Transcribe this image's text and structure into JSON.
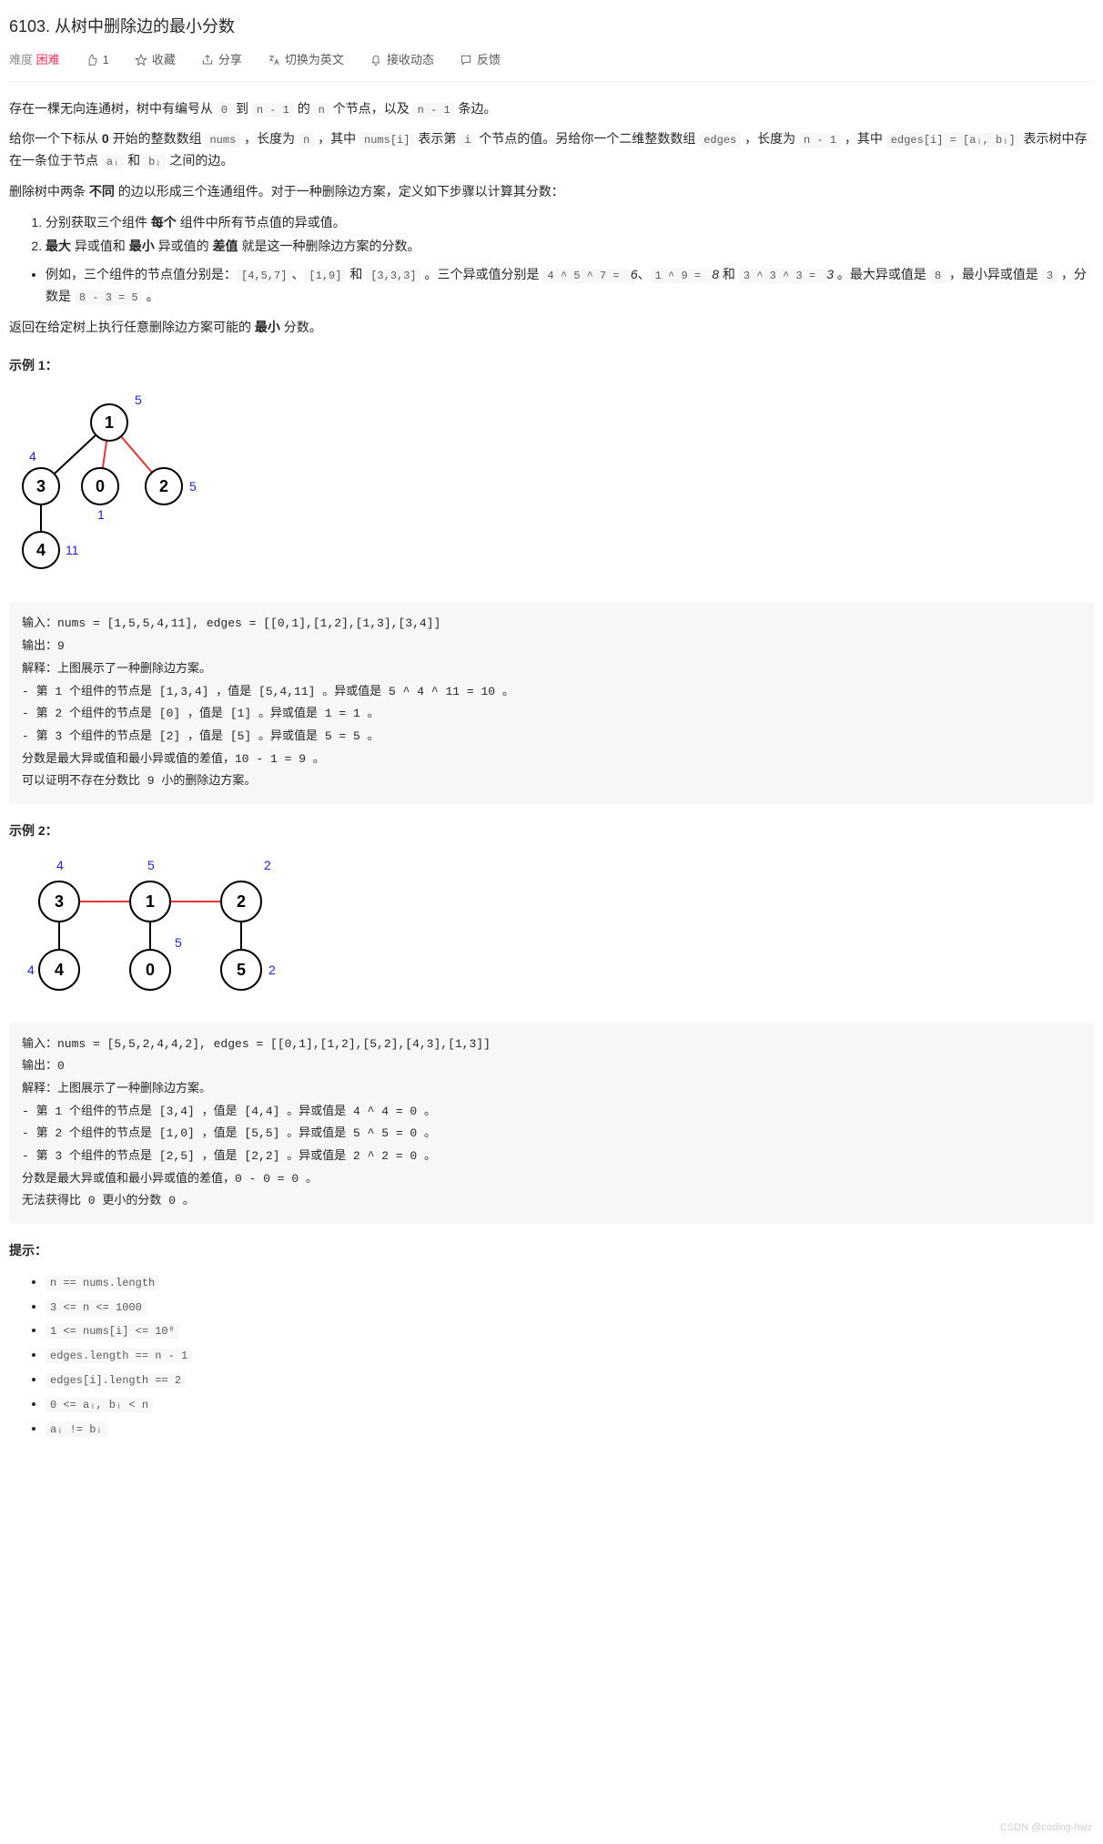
{
  "title": "6103. 从树中删除边的最小分数",
  "toolbar": {
    "difficulty_label": "难度",
    "difficulty_value": "困难",
    "like_count": "1",
    "favorite": "收藏",
    "share": "分享",
    "translate": "切换为英文",
    "subscribe": "接收动态",
    "feedback": "反馈"
  },
  "desc": {
    "p1a": "存在一棵无向连通树，树中有编号从 ",
    "p1_c1": "0",
    "p1b": " 到 ",
    "p1_c2": "n - 1",
    "p1c": " 的 ",
    "p1_c3": "n",
    "p1d": " 个节点，以及 ",
    "p1_c4": "n - 1",
    "p1e": " 条边。",
    "p2a": "给你一个下标从 ",
    "p2_b0": "0",
    "p2b": " 开始的整数数组 ",
    "p2_c1": "nums",
    "p2c": " ，长度为 ",
    "p2_c2": "n",
    "p2d": " ，其中 ",
    "p2_c3": "nums[i]",
    "p2e": " 表示第 ",
    "p2_c4": "i",
    "p2f": " 个节点的值。另给你一个二维整数数组 ",
    "p2_c5": "edges",
    "p2g": " ，长度为 ",
    "p2_c6": "n - 1",
    "p2h": " ，其中 ",
    "p2_c7": "edges[i] = [aᵢ, bᵢ]",
    "p2i": " 表示树中存在一条位于节点 ",
    "p2_c8": "aᵢ",
    "p2j": " 和 ",
    "p2_c9": "bᵢ",
    "p2k": " 之间的边。",
    "p3a": "删除树中两条 ",
    "p3_b1": "不同",
    "p3b": " 的边以形成三个连通组件。对于一种删除边方案，定义如下步骤以计算其分数：",
    "ol1": "分别获取三个组件 每个 组件中所有节点值的异或值。",
    "ol2": "最大 异或值和 最小 异或值的 差值 就是这一种删除边方案的分数。",
    "ula": "例如，三个组件的节点值分别是：",
    "ul_c1": "[4,5,7]",
    "ulb": "、",
    "ul_c2": "[1,9]",
    "ulc": " 和 ",
    "ul_c3": "[3,3,3]",
    "uld": " 。三个异或值分别是 ",
    "ul_c4": "4 ^ 5 ^ 7 = ",
    "ul_e1": "6",
    "ule": "、",
    "ul_c5": "1 ^ 9 = ",
    "ul_e2": "8",
    "ulf": " 和 ",
    "ul_c6": "3 ^ 3 ^ 3 = ",
    "ul_e3": "3",
    "ulg": " 。最大异或值是 ",
    "ul_c7": "8",
    "ulh": " ，最小异或值是 ",
    "ul_c8": "3",
    "uli": " ，分数是 ",
    "ul_c9": "8 - 3 = 5",
    "ulj": " 。",
    "p4a": "返回在给定树上执行任意删除边方案可能的 ",
    "p4_b": "最小",
    "p4b": " 分数。"
  },
  "ex1": {
    "title": "示例 1：",
    "svg": {
      "n1": "1",
      "n3": "3",
      "n0": "0",
      "n2": "2",
      "n4": "4",
      "l5": "5",
      "l4": "4",
      "l5b": "5",
      "l1": "1",
      "l11": "11"
    },
    "box": "输入：nums = [1,5,5,4,11], edges = [[0,1],[1,2],[1,3],[3,4]]\n输出：9\n解释：上图展示了一种删除边方案。\n- 第 1 个组件的节点是 [1,3,4] ，值是 [5,4,11] 。异或值是 5 ^ 4 ^ 11 = 10 。\n- 第 2 个组件的节点是 [0] ，值是 [1] 。异或值是 1 = 1 。\n- 第 3 个组件的节点是 [2] ，值是 [5] 。异或值是 5 = 5 。\n分数是最大异或值和最小异或值的差值，10 - 1 = 9 。\n可以证明不存在分数比 9 小的删除边方案。"
  },
  "ex2": {
    "title": "示例 2：",
    "svg": {
      "n3": "3",
      "n1": "1",
      "n2": "2",
      "n4": "4",
      "n0": "0",
      "n5": "5",
      "l4": "4",
      "l5": "5",
      "l2": "2",
      "l5b": "5",
      "l4b": "4",
      "l2b": "2"
    },
    "box": "输入：nums = [5,5,2,4,4,2], edges = [[0,1],[1,2],[5,2],[4,3],[1,3]]\n输出：0\n解释：上图展示了一种删除边方案。\n- 第 1 个组件的节点是 [3,4] ，值是 [4,4] 。异或值是 4 ^ 4 = 0 。\n- 第 2 个组件的节点是 [1,0] ，值是 [5,5] 。异或值是 5 ^ 5 = 0 。\n- 第 3 个组件的节点是 [2,5] ，值是 [2,2] 。异或值是 2 ^ 2 = 0 。\n分数是最大异或值和最小异或值的差值，0 - 0 = 0 。\n无法获得比 0 更小的分数 0 。"
  },
  "constraints": {
    "title": "提示：",
    "items": [
      "n == nums.length",
      "3 <= n <= 1000",
      "1 <= nums[i] <= 10⁸",
      "edges.length == n - 1",
      "edges[i].length == 2",
      "0 <= aᵢ, bᵢ < n",
      "aᵢ != bᵢ"
    ]
  },
  "watermark": "CSDN @coding-hwz"
}
